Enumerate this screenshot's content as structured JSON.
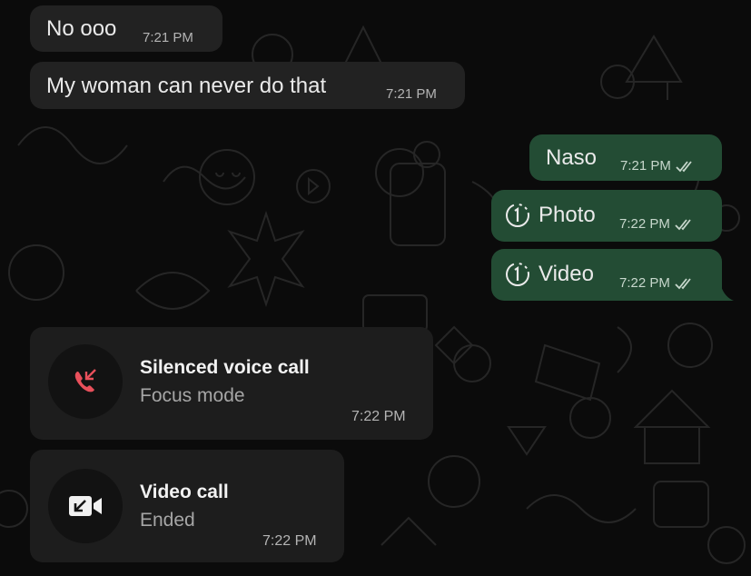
{
  "colors": {
    "background": "#0b0b0b",
    "incoming_bubble": "#222222",
    "outgoing_bubble": "#234c34",
    "missed_call_icon": "#e8505b"
  },
  "messages": [
    {
      "direction": "in",
      "text": "No ooo",
      "time": "7:21 PM"
    },
    {
      "direction": "in",
      "text": "My woman can never do that",
      "time": "7:21 PM"
    },
    {
      "direction": "out",
      "text": "Naso",
      "time": "7:21 PM",
      "status": "read"
    },
    {
      "direction": "out",
      "type": "view-once",
      "icon": "view-once-icon",
      "text": "Photo",
      "time": "7:22 PM",
      "status": "read"
    },
    {
      "direction": "out",
      "type": "view-once",
      "icon": "view-once-icon",
      "text": "Video",
      "time": "7:22 PM",
      "status": "read"
    }
  ],
  "calls": [
    {
      "icon": "missed-call-icon",
      "title": "Silenced voice call",
      "subtitle": "Focus mode",
      "time": "7:22 PM"
    },
    {
      "icon": "video-call-icon",
      "title": "Video call",
      "subtitle": "Ended",
      "time": "7:22 PM"
    }
  ]
}
